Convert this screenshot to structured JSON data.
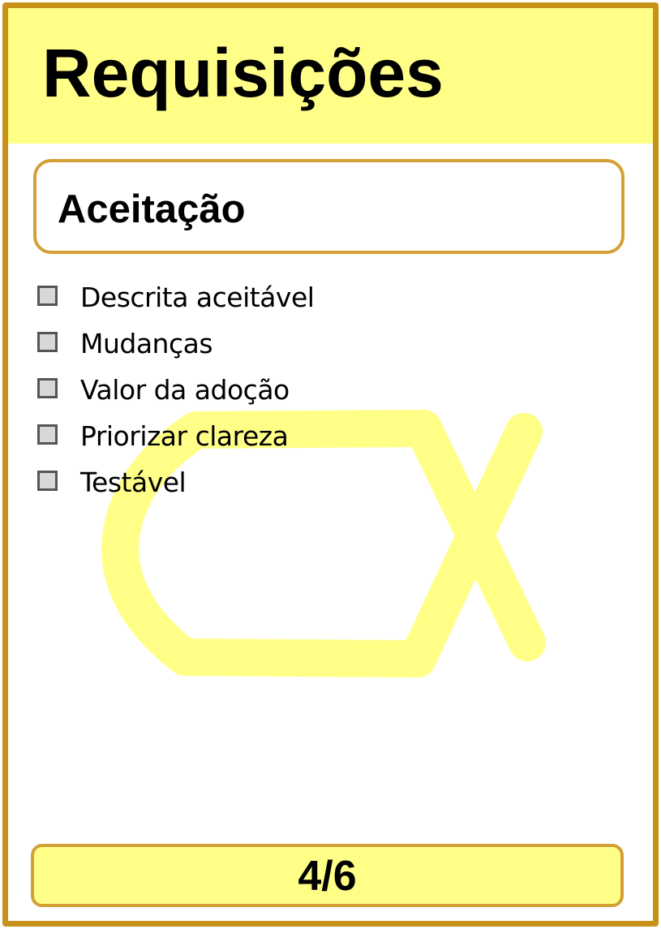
{
  "card": {
    "title": "Requisições",
    "section_title": "Aceitação",
    "checklist": [
      {
        "label": "Descrita aceitável",
        "checked": false
      },
      {
        "label": "Mudanças",
        "checked": false
      },
      {
        "label": "Valor da adoção",
        "checked": false
      },
      {
        "label": "Priorizar clareza",
        "checked": false
      },
      {
        "label": "Testável",
        "checked": false
      }
    ],
    "page_indicator": "4/6",
    "watermark_icon": "cx-logo-icon"
  },
  "colors": {
    "border": "#c8921a",
    "header_bg": "#ffff88",
    "box_border": "#d4a036",
    "watermark": "#ffff88"
  }
}
